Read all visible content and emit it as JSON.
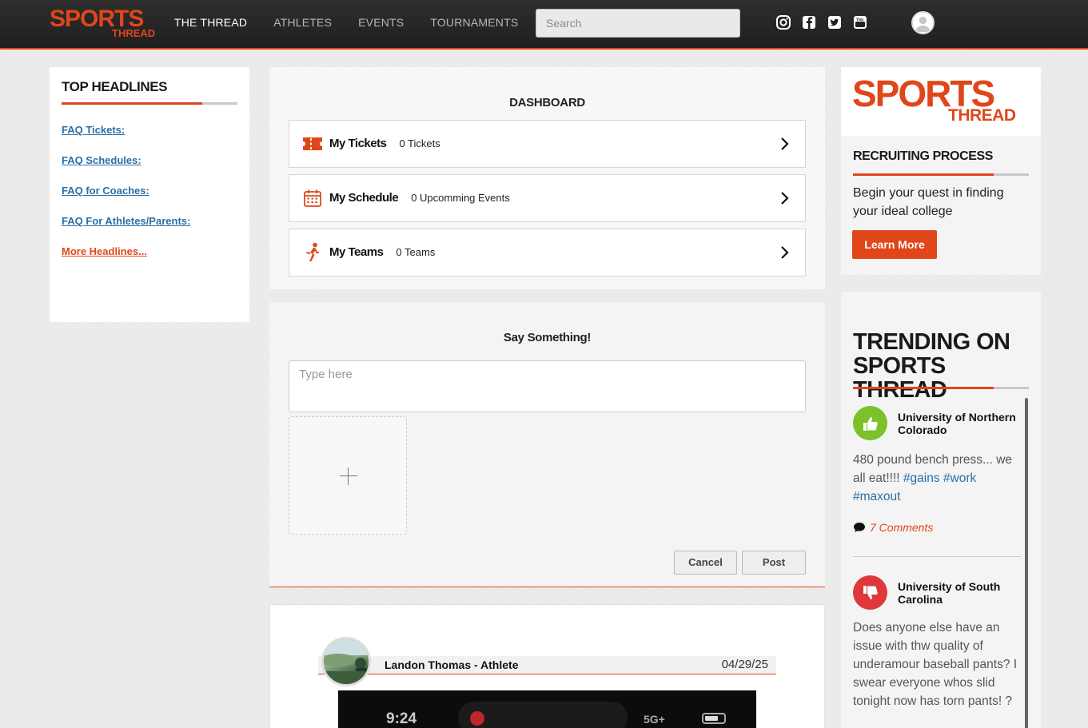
{
  "header": {
    "logo_big": "SPORTS",
    "logo_small": "THREAD",
    "nav": [
      {
        "label": "THE THREAD"
      },
      {
        "label": "ATHLETES"
      },
      {
        "label": "EVENTS"
      },
      {
        "label": "TOURNAMENTS"
      }
    ],
    "search_placeholder": "Search",
    "social_icons": [
      "instagram-icon",
      "facebook-icon",
      "twitter-icon",
      "youtube-icon"
    ]
  },
  "left": {
    "title": "TOP HEADLINES",
    "links": [
      {
        "label": "FAQ Tickets:"
      },
      {
        "label": "FAQ Schedules:"
      },
      {
        "label": "FAQ for Coaches:"
      },
      {
        "label": "FAQ For Athletes/Parents:"
      },
      {
        "label": "More Headlines..."
      }
    ]
  },
  "dashboard": {
    "title": "DASHBOARD",
    "rows": [
      {
        "label": "My Tickets",
        "count": "0 Tickets",
        "icon": "ticket-icon"
      },
      {
        "label": "My Schedule",
        "count": "0 Upcomming Events",
        "icon": "calendar-icon"
      },
      {
        "label": "My Teams",
        "count": "0 Teams",
        "icon": "athlete-icon"
      }
    ]
  },
  "composer": {
    "title": "Say Something!",
    "placeholder": "Type here",
    "cancel_label": "Cancel",
    "post_label": "Post"
  },
  "feed": {
    "author": "Landon Thomas - Athlete",
    "date": "04/29/25",
    "image_time": "9:24",
    "image_signal": "5G+"
  },
  "promo": {
    "logo_big": "SPORTS",
    "logo_small": "THREAD",
    "title": "RECRUITING PROCESS",
    "text": "Begin your quest in finding your ideal college",
    "button_label": "Learn More"
  },
  "trending": {
    "title": "TRENDING ON SPORTS THREAD",
    "items": [
      {
        "name": "University of Northern Colorado",
        "text": "480 pound bench press... we all eat!!!!",
        "tags": [
          "#gains",
          "#work",
          "#maxout"
        ],
        "comments": "7 Comments",
        "sentiment": "thumbs-up-icon"
      },
      {
        "name": "University of South Carolina",
        "text": "Does anyone else have an issue with thw quality of underamour baseball pants? I swear everyone whos slid tonight now has torn pants! ?",
        "sentiment": "thumbs-down-icon"
      }
    ]
  },
  "colors": {
    "accent": "#e0461a",
    "link": "#2a6fa8",
    "thumbs_up": "#7dc12a",
    "thumbs_down": "#e0373a"
  }
}
